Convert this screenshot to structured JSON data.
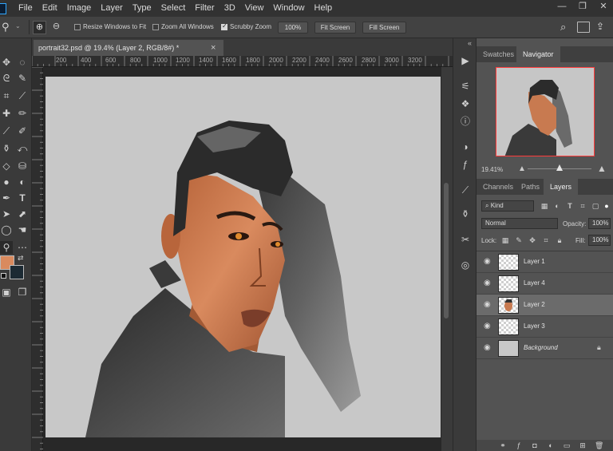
{
  "menu": {
    "items": [
      "File",
      "Edit",
      "Image",
      "Layer",
      "Type",
      "Select",
      "Filter",
      "3D",
      "View",
      "Window",
      "Help"
    ]
  },
  "window_controls": {
    "minimize": "—",
    "restore": "❐",
    "close": "✕"
  },
  "options_bar": {
    "resize_windows": {
      "label": "Resize Windows to Fit",
      "checked": false
    },
    "zoom_all": {
      "label": "Zoom All Windows",
      "checked": false
    },
    "scrubby_zoom": {
      "label": "Scrubby Zoom",
      "checked": true
    },
    "zoom_100": "100%",
    "fit_screen": "Fit Screen",
    "fill_screen": "Fill Screen"
  },
  "document": {
    "tab_title": "portrait32.psd @ 19.4% (Layer 2, RGB/8#) *",
    "close": "×",
    "ruler_ticks": [
      "200",
      "400",
      "600",
      "800",
      "1000",
      "1200",
      "1400",
      "1600",
      "1800",
      "2000",
      "2200",
      "2400",
      "2600",
      "2800",
      "3000",
      "3200"
    ]
  },
  "navigator": {
    "tabs": [
      "Swatches",
      "Navigator"
    ],
    "active_tab": "Navigator",
    "zoom": "19.41%",
    "slider_fraction": 0.5
  },
  "layers_panel": {
    "tabs": [
      "Channels",
      "Paths",
      "Layers"
    ],
    "active_tab": "Layers",
    "filter_kind": "Kind",
    "blend_mode": "Normal",
    "opacity_label": "Opacity:",
    "opacity": "100%",
    "lock_label": "Lock:",
    "fill_label": "Fill:",
    "fill": "100%",
    "layers": [
      {
        "name": "Layer 1",
        "selected": false,
        "italic": false
      },
      {
        "name": "Layer 4",
        "selected": false,
        "italic": false
      },
      {
        "name": "Layer 2",
        "selected": true,
        "italic": false
      },
      {
        "name": "Layer 3",
        "selected": false,
        "italic": false
      },
      {
        "name": "Background",
        "selected": false,
        "italic": true
      }
    ]
  },
  "colors": {
    "foreground": "#d98a5e",
    "background": "#1c2a33",
    "accent": "#31a8ff"
  }
}
